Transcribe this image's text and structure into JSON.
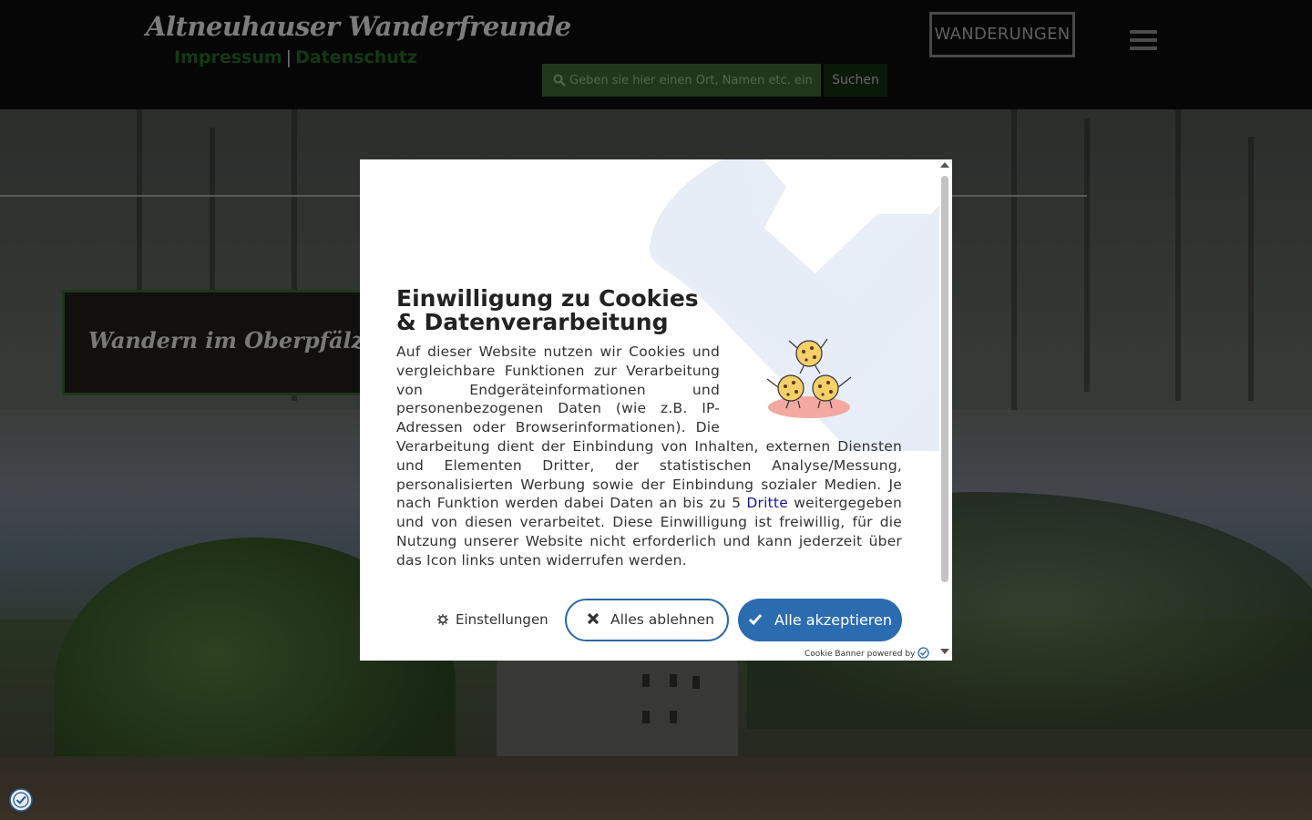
{
  "header": {
    "site_title": "Altneuhauser Wanderfreunde",
    "links": [
      {
        "label": "Impressum"
      },
      {
        "label": "Datenschutz"
      }
    ],
    "separator": "|",
    "search": {
      "placeholder": "Geben sie hier einen Ort, Namen etc. ein",
      "button_label": "Suchen"
    },
    "nav_button_label": "WANDERUNGEN",
    "menu_icon": "hamburger-icon"
  },
  "hero": {
    "text": "Wandern im Oberpfälzer Wald"
  },
  "cookie_banner": {
    "title": "Einwilligung zu Cookies & Datenverarbeitung",
    "body_before_link": "Auf dieser Website nutzen wir Cookies und vergleichbare Funktionen zur Verarbeitung von Endgeräteinformationen und personenbezogenen Daten (wie z.B. IP-Adressen oder Browserinformationen). Die Verarbeitung dient der Einbindung von Inhalten, externen Diensten und Elementen Dritter, der statistischen Analyse/Messung, personalisierten Werbung sowie der Einbindung sozialer Medien. Je nach Funktion werden dabei Daten an bis zu 5 ",
    "link_label": "Dritte",
    "body_after_link": " weitergegeben und von diesen verarbeitet. Diese Einwilligung ist freiwillig, für die Nutzung unserer Website nicht erforderlich und kann jederzeit über das Icon links unten widerrufen werden.",
    "settings_label": "Einstellungen",
    "reject_label": "Alles ablehnen",
    "accept_label": "Alle akzeptieren",
    "powered_by": "Cookie Banner powered by",
    "accent_color": "#2b6cb0"
  }
}
